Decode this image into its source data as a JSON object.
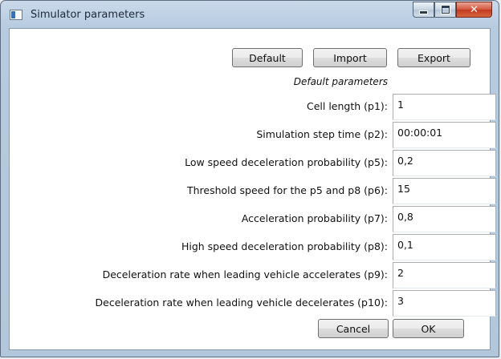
{
  "window": {
    "title": "Simulator parameters",
    "icons": {
      "app": "window-app-icon",
      "minimize": "minimize-icon",
      "maximize": "maximize-icon",
      "close": "close-icon"
    },
    "close_glyph": "✕"
  },
  "toolbar": {
    "default_label": "Default",
    "import_label": "Import",
    "export_label": "Export"
  },
  "subtitle": "Default parameters",
  "params": [
    {
      "label": "Cell length (p1):",
      "value": "1"
    },
    {
      "label": "Simulation step time (p2):",
      "value": "00:00:01"
    },
    {
      "label": "Low speed deceleration probability (p5):",
      "value": "0,2"
    },
    {
      "label": "Threshold speed for the p5 and p8 (p6):",
      "value": "15"
    },
    {
      "label": "Acceleration probability (p7):",
      "value": "0,8"
    },
    {
      "label": "High speed deceleration probability (p8):",
      "value": "0,1"
    },
    {
      "label": "Deceleration rate when leading vehicle accelerates (p9):",
      "value": "2"
    },
    {
      "label": "Deceleration rate when leading vehicle decelerates (p10):",
      "value": "3"
    }
  ],
  "footer": {
    "cancel_label": "Cancel",
    "ok_label": "OK"
  }
}
